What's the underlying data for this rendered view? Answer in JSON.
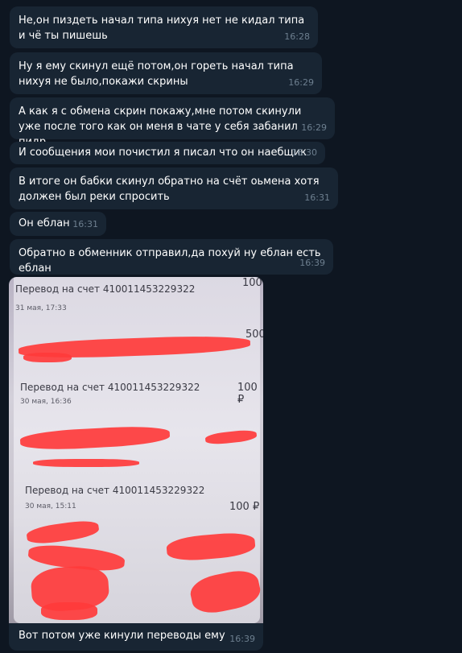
{
  "messages": [
    {
      "text": "Не,он пиздеть начал типа нихуя нет не кидал типа и чё ты пишешь",
      "time": "16:28"
    },
    {
      "text": "Ну я ему скинул ещё потом,он гореть начал типа нихуя не было,покажи скрины",
      "time": "16:29"
    },
    {
      "text": "А как я с обмена скрин покажу,мне потом скинули уже после того как он меня в чате у себя забанил пидр",
      "time": "16:29"
    },
    {
      "text": "И сообщения мои почистил я писал что он наебщик",
      "time": "16:30"
    },
    {
      "text": "В итоге он бабки скинул обратно на счёт оьмена хотя должен был реки спросить",
      "time": "16:31"
    },
    {
      "text": "Он еблан",
      "time": "16:31"
    },
    {
      "text": "Обратно в обменник отправил,да похуй ну еблан есть еблан",
      "time": "16:39"
    }
  ],
  "media_message": {
    "caption": "Вот потом уже кинули переводы ему",
    "time": "16:39",
    "photo": {
      "entries": [
        {
          "title": "Перевод на счет 410011453229322",
          "date": "31 мая, 17:33",
          "amount": "100"
        },
        {
          "title": "Перевод на счет 410011453229322",
          "date": "30 мая, 16:36",
          "amount": "100 ₽"
        },
        {
          "title": "Перевод на счет 410011453229322",
          "date": "30 мая, 15:11",
          "amount": "100 ₽"
        }
      ],
      "partial_amount": "500",
      "redaction_color": "#ff3b3b"
    }
  },
  "colors": {
    "background": "#0e1621",
    "bubble": "#182533",
    "time": "#6d7f8f"
  }
}
